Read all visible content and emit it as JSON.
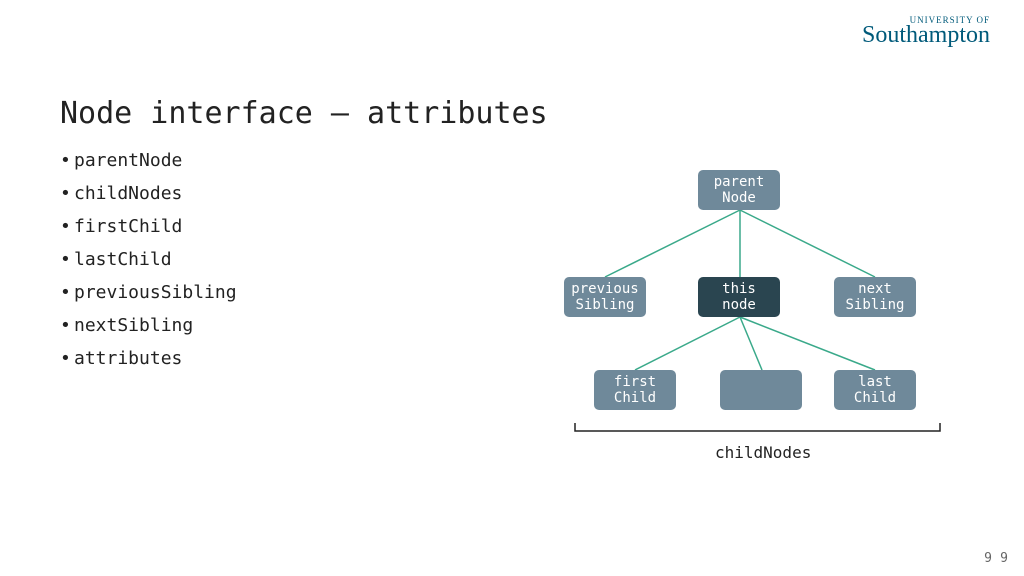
{
  "logo": {
    "line1": "UNIVERSITY OF",
    "line2": "Southampton"
  },
  "title": "Node interface – attributes",
  "bullets": [
    "parentNode",
    "childNodes",
    "firstChild",
    "lastChild",
    "previousSibling",
    "nextSibling",
    "attributes"
  ],
  "diagram": {
    "parent": {
      "l1": "parent",
      "l2": "Node"
    },
    "prev": {
      "l1": "previous",
      "l2": "Sibling"
    },
    "this": {
      "l1": "this",
      "l2": "node"
    },
    "next": {
      "l1": "next",
      "l2": "Sibling"
    },
    "first": {
      "l1": "first",
      "l2": "Child"
    },
    "middle": {
      "l1": "",
      "l2": ""
    },
    "last": {
      "l1": "last",
      "l2": "Child"
    },
    "bracket_label": "childNodes"
  },
  "page_number_a": "9",
  "page_number_b": "9"
}
